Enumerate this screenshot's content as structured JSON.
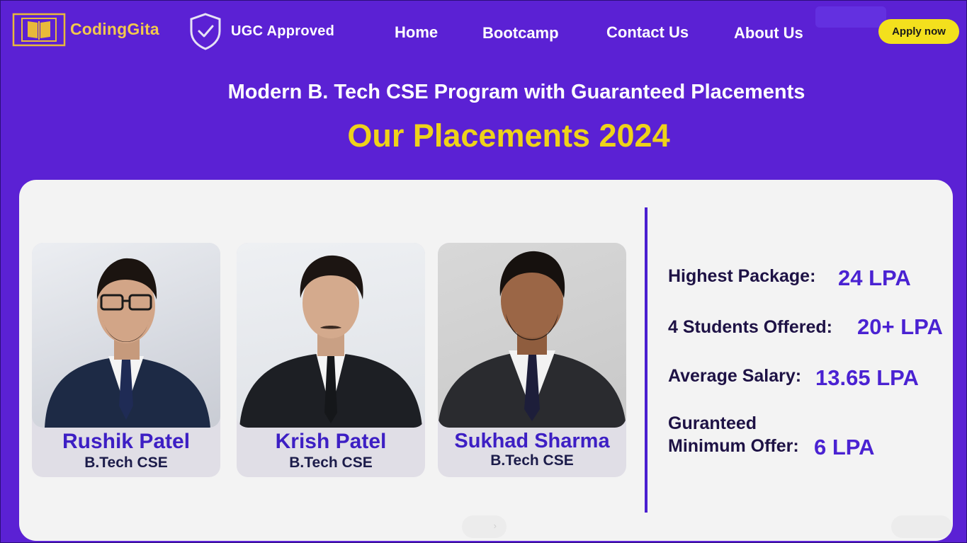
{
  "header": {
    "brand": "CodingGita",
    "ugc": "UGC Approved",
    "nav": [
      "Home",
      "Bootcamp",
      "Contact Us",
      "About Us"
    ],
    "apply": "Apply now"
  },
  "hero": {
    "subtitle": "Modern B. Tech CSE Program with Guaranteed Placements",
    "heading": "Our Placements 2024"
  },
  "students": [
    {
      "name": "Rushik Patel",
      "degree": "B.Tech CSE"
    },
    {
      "name": "Krish Patel",
      "degree": "B.Tech CSE"
    },
    {
      "name": "Sukhad Sharma",
      "degree": "B.Tech CSE"
    }
  ],
  "stats": {
    "highest_label": "Highest Package:",
    "highest_value": "24 LPA",
    "offered_label": "4 Students Offered:",
    "offered_value": "20+ LPA",
    "average_label": "Average Salary:",
    "average_value": "13.65 LPA",
    "min_label_1": "Guranteed",
    "min_label_2": "Minimum Offer:",
    "min_value": "6 LPA"
  },
  "colors": {
    "background": "#5b21d4",
    "accent_yellow": "#eed21a",
    "value_purple": "#4a22d2"
  },
  "icons": [
    "book-logo-icon",
    "shield-check-icon",
    "chevron-right-icon"
  ]
}
